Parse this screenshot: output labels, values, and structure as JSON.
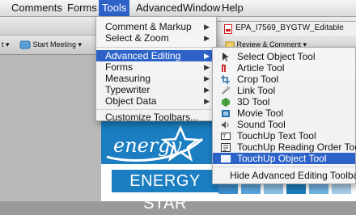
{
  "menubar": {
    "items": [
      "Comments",
      "Forms",
      "Tools",
      "Advanced",
      "Window",
      "Help"
    ]
  },
  "toolbar": {
    "start_meeting": "Start Meeting",
    "review_comment": "Review & Comment"
  },
  "document_tab": {
    "title": "EPA_I7569_BYGTW_Editable"
  },
  "document": {
    "brand_script": "energy",
    "brand_text": "ENERGY STAR"
  },
  "tools_menu": {
    "items": [
      {
        "label": "Comment & Markup",
        "has_submenu": true
      },
      {
        "label": "Select & Zoom",
        "has_submenu": true
      },
      {
        "label": "Advanced Editing",
        "has_submenu": true,
        "highlighted": true
      },
      {
        "label": "Forms",
        "has_submenu": true
      },
      {
        "label": "Measuring",
        "has_submenu": true
      },
      {
        "label": "Typewriter",
        "has_submenu": true
      },
      {
        "label": "Object Data",
        "has_submenu": true
      },
      {
        "label": "Customize Toolbars...",
        "has_submenu": false
      }
    ]
  },
  "advanced_editing_menu": {
    "items": [
      {
        "label": "Select Object Tool",
        "icon": "pointer-icon"
      },
      {
        "label": "Article Tool",
        "icon": "article-icon"
      },
      {
        "label": "Crop Tool",
        "icon": "crop-icon"
      },
      {
        "label": "Link Tool",
        "icon": "link-icon"
      },
      {
        "label": "3D Tool",
        "icon": "3d-icon"
      },
      {
        "label": "Movie Tool",
        "icon": "movie-icon"
      },
      {
        "label": "Sound Tool",
        "icon": "sound-icon"
      },
      {
        "label": "TouchUp Text Tool",
        "icon": "touchup-text-icon"
      },
      {
        "label": "TouchUp Reading Order Tool",
        "icon": "reading-order-icon"
      },
      {
        "label": "TouchUp Object Tool",
        "icon": "touchup-object-icon",
        "highlighted": true
      },
      {
        "label": "Hide Advanced Editing Toolbar",
        "icon": ""
      }
    ]
  },
  "colors": {
    "menu_highlight": "#2d62c9",
    "energy_blue": "#1b7ec1"
  }
}
